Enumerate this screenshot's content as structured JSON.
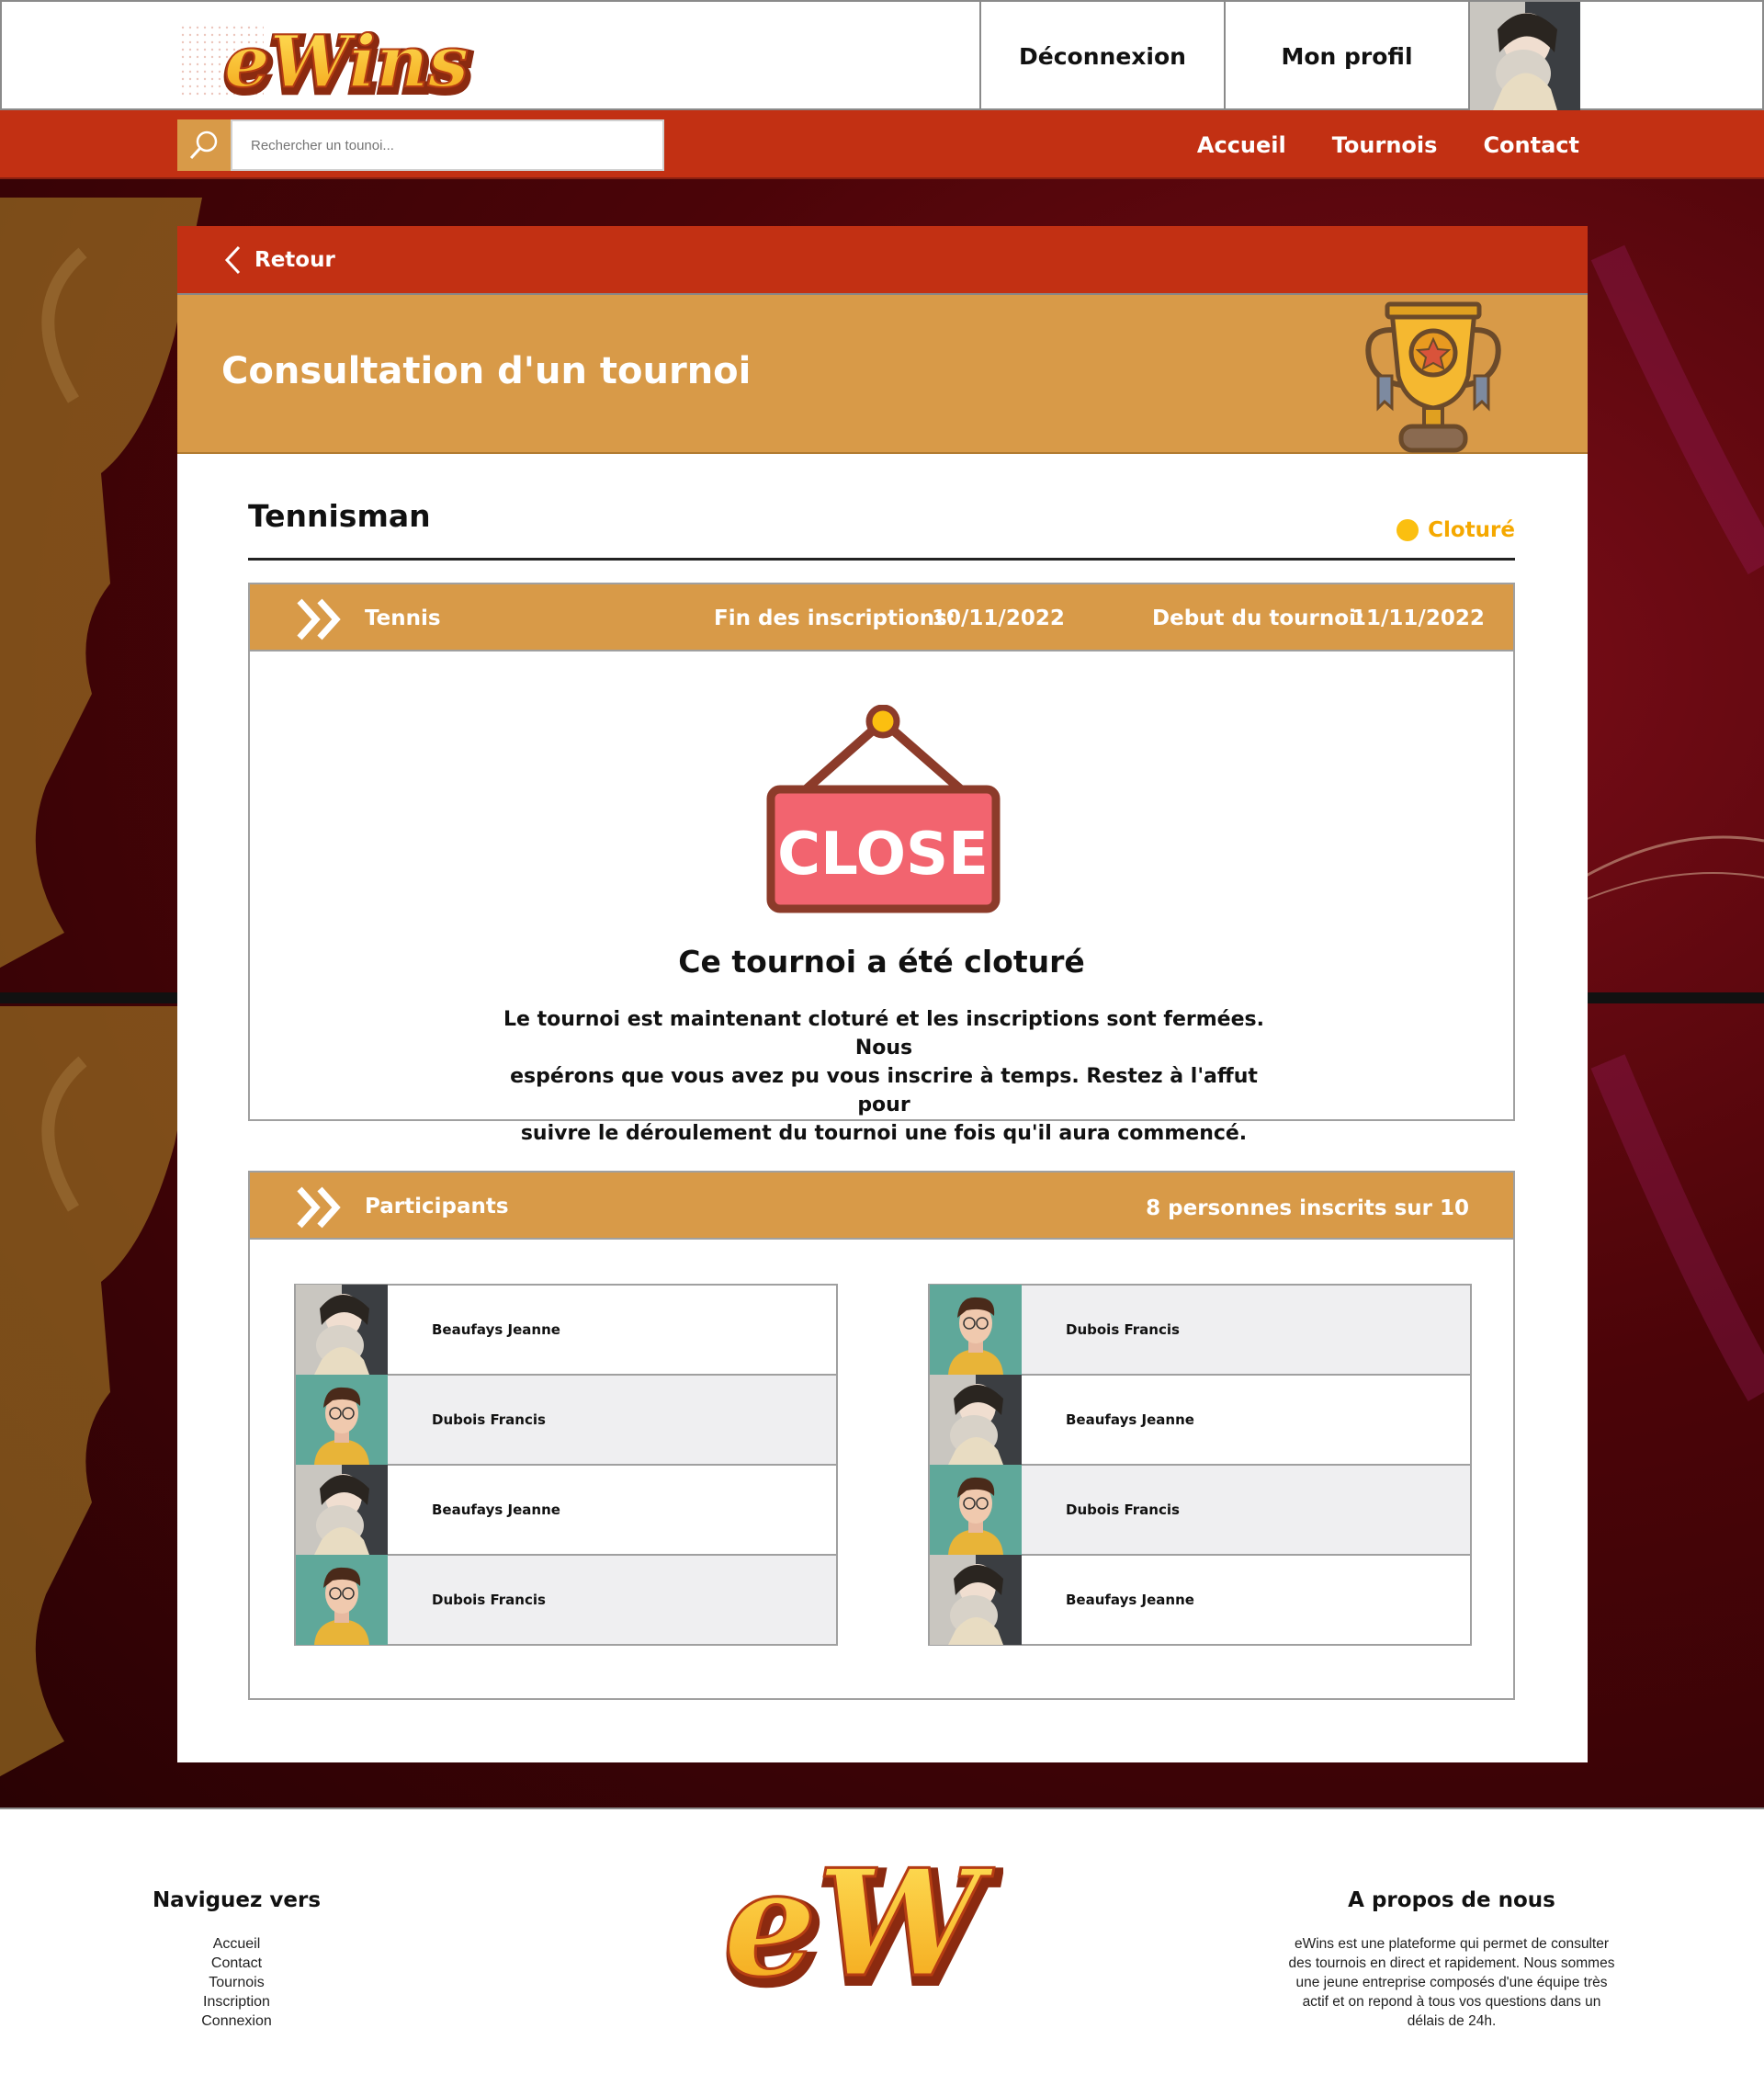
{
  "header": {
    "logo_text": "eWins",
    "logout_label": "Déconnexion",
    "profile_label": "Mon profil",
    "search_placeholder": "Rechercher un tounoi...",
    "nav": [
      "Accueil",
      "Tournois",
      "Contact"
    ]
  },
  "card": {
    "back_label": "Retour",
    "page_title": "Consultation d'un tournoi",
    "tournament_name": "Tennisman",
    "status": "Cloturé",
    "info": {
      "sport": "Tennis",
      "signup_end_label": "Fin des inscriptions:",
      "signup_end_date": "10/11/2022",
      "start_label": "Debut du tournoi:",
      "start_date": "11/11/2022"
    },
    "closed": {
      "sign_text": "CLOSE",
      "title": "Ce tournoi a été cloturé",
      "message_lines": [
        "Le tournoi est maintenant cloturé et les inscriptions sont fermées. Nous",
        "espérons que vous avez pu vous inscrire à temps. Restez à l'affut pour",
        "suivre le déroulement du tournoi une fois qu'il aura commencé."
      ]
    },
    "participants": {
      "title": "Participants",
      "count_text": "8 personnes inscrits sur 10",
      "left": [
        {
          "name": "Beaufays Jeanne",
          "avatar": "woman-cat"
        },
        {
          "name": "Dubois Francis",
          "avatar": "man-glasses"
        },
        {
          "name": "Beaufays Jeanne",
          "avatar": "woman-cat"
        },
        {
          "name": "Dubois Francis",
          "avatar": "man-glasses"
        }
      ],
      "right": [
        {
          "name": "Dubois Francis",
          "avatar": "man-glasses"
        },
        {
          "name": "Beaufays Jeanne",
          "avatar": "woman-cat"
        },
        {
          "name": "Dubois Francis",
          "avatar": "man-glasses"
        },
        {
          "name": "Beaufays Jeanne",
          "avatar": "woman-cat"
        }
      ]
    }
  },
  "footer": {
    "nav_title": "Naviguez vers",
    "nav_links": [
      "Accueil",
      "Contact",
      "Tournois",
      "Inscription",
      "Connexion"
    ],
    "logo_text": "eW",
    "about_title": "A propos de nous",
    "about_lines": [
      "eWins est une plateforme qui permet de consulter",
      "des tournois en direct et rapidement. Nous sommes",
      "une jeune entreprise composés d'une équipe très",
      "actif et on repond à tous vos questions dans un",
      "délais de 24h."
    ]
  },
  "colors": {
    "red": "#c23013",
    "orange": "#d89a48",
    "status_yellow": "#fbbf10"
  }
}
